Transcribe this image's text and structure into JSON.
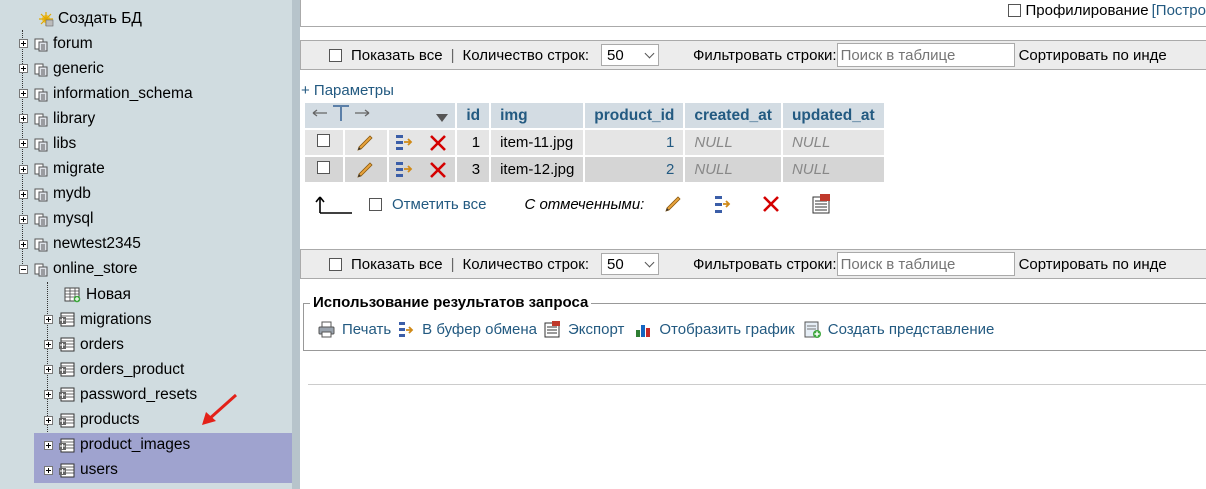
{
  "sidebar": {
    "create_db": "Создать БД",
    "databases": [
      {
        "name": "forum"
      },
      {
        "name": "generic"
      },
      {
        "name": "information_schema"
      },
      {
        "name": "library"
      },
      {
        "name": "libs"
      },
      {
        "name": "migrate"
      },
      {
        "name": "mydb"
      },
      {
        "name": "mysql"
      },
      {
        "name": "newtest2345"
      },
      {
        "name": "online_store"
      }
    ],
    "tables": [
      {
        "name": "Новая"
      },
      {
        "name": "migrations"
      },
      {
        "name": "orders"
      },
      {
        "name": "orders_product"
      },
      {
        "name": "password_resets"
      },
      {
        "name": "products"
      },
      {
        "name": "product_images",
        "selected": true
      },
      {
        "name": "users",
        "selected": true
      }
    ]
  },
  "topbar": {
    "profiling_label": "Профилирование",
    "bracket_link": "[Постро"
  },
  "navbar": {
    "show_all": "Показать все",
    "row_count_label": "Количество строк:",
    "row_count_value": "50",
    "filter_label": "Фильтровать строки:",
    "search_placeholder": "Поиск в таблице",
    "sort_label": "Сортировать по инде"
  },
  "options_link": "+ Параметры",
  "table": {
    "columns": [
      "id",
      "img",
      "product_id",
      "created_at",
      "updated_at"
    ],
    "rows": [
      {
        "id": "1",
        "img": "item-11.jpg",
        "product_id": "1",
        "created_at": "NULL",
        "updated_at": "NULL"
      },
      {
        "id": "3",
        "img": "item-12.jpg",
        "product_id": "2",
        "created_at": "NULL",
        "updated_at": "NULL"
      }
    ]
  },
  "bulk": {
    "check_all": "Отметить все",
    "with_selected": "С отмеченными:"
  },
  "query_results": {
    "legend": "Использование результатов запроса",
    "print": "Печать",
    "clipboard": "В буфер обмена",
    "export": "Экспорт",
    "chart": "Отобразить график",
    "create_view": "Создать представление"
  },
  "colors": {
    "link": "#235a81",
    "sidebar_bg": "#d0dce0",
    "selected_bg": "#9fa3cf",
    "header_bg": "#d3dce3"
  }
}
